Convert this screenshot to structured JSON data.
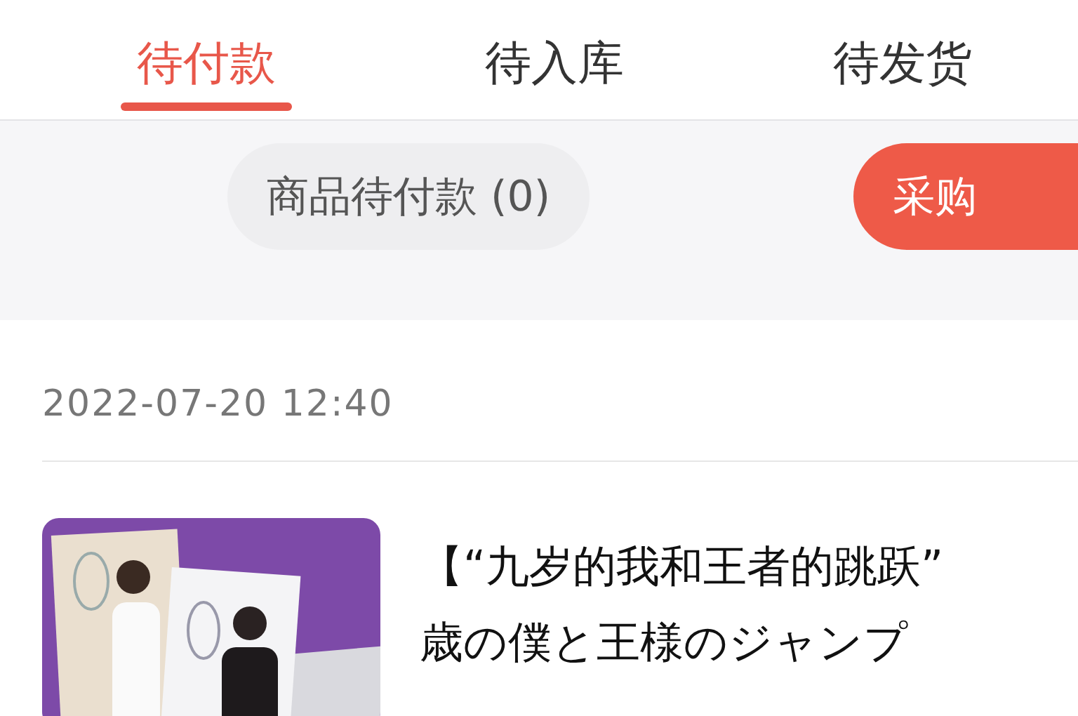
{
  "tabs": [
    {
      "label": "待付款",
      "selected": true
    },
    {
      "label": "待入库",
      "selected": false
    },
    {
      "label": "待发货",
      "selected": false
    }
  ],
  "filters": [
    {
      "label": "商品待付款 (0)",
      "selected": false
    },
    {
      "label": "采购",
      "selected": true
    }
  ],
  "order": {
    "time": "2022-07-20 12:40",
    "product": {
      "image": {
        "kind": "picture"
      },
      "title_lines": [
        "【“九岁的我和王者的跳跃”",
        "歳の僕と王様のジャンプ"
      ]
    }
  }
}
